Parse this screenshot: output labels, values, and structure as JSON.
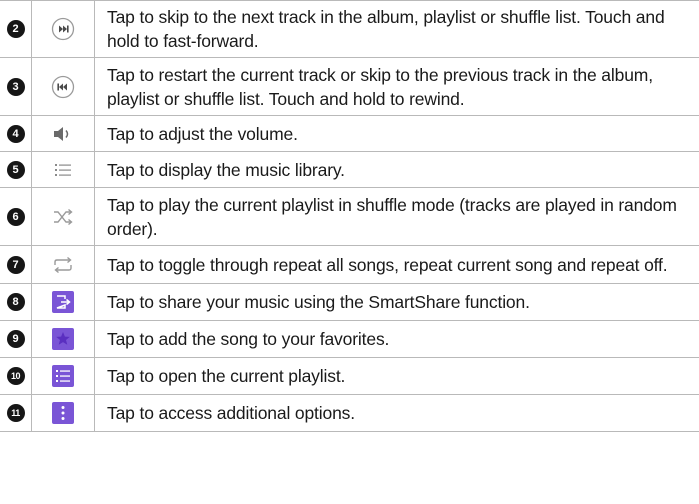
{
  "rows": [
    {
      "number": "2",
      "icon": "next-track-icon",
      "text": "Tap to skip to the next track in the album, playlist or shuffle list. Touch and hold to fast-forward."
    },
    {
      "number": "3",
      "icon": "previous-track-icon",
      "text": "Tap to restart the current track or skip to the previous track in the album, playlist or shuffle list. Touch and hold to rewind."
    },
    {
      "number": "4",
      "icon": "volume-icon",
      "text": "Tap to adjust the volume."
    },
    {
      "number": "5",
      "icon": "music-library-icon",
      "text": "Tap to display the music library."
    },
    {
      "number": "6",
      "icon": "shuffle-icon",
      "text": "Tap to play the current playlist in shuffle mode (tracks are played in random order)."
    },
    {
      "number": "7",
      "icon": "repeat-icon",
      "text": "Tap to toggle through repeat all songs, repeat current song and repeat off."
    },
    {
      "number": "8",
      "icon": "smartshare-icon",
      "text": "Tap to share your music using the SmartShare function."
    },
    {
      "number": "9",
      "icon": "favorite-star-icon",
      "text": "Tap to add the song to your favorites."
    },
    {
      "number": "10",
      "icon": "playlist-icon",
      "text": "Tap to open the current playlist."
    },
    {
      "number": "11",
      "icon": "more-options-icon",
      "text": "Tap to access additional options."
    }
  ],
  "colors": {
    "icon_gray": "#9a9a9a",
    "icon_dark": "#4a4a4a",
    "accent_purple": "#7a55d6",
    "badge": "#161616",
    "border": "#b9b9b9"
  }
}
